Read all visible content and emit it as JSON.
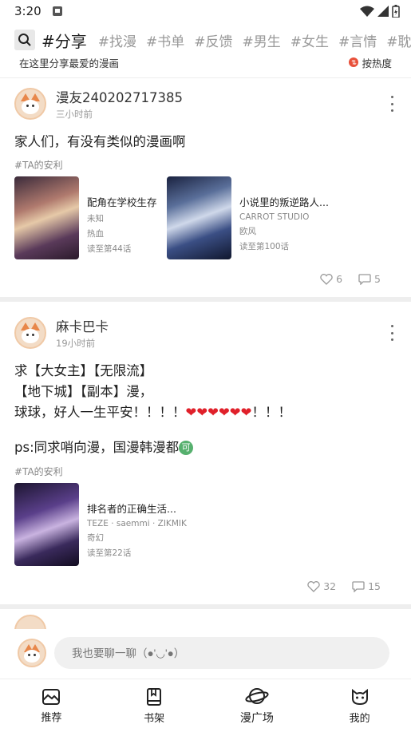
{
  "status_bar": {
    "time": "3:20"
  },
  "tags": {
    "search_icon": "search-icon",
    "items": [
      {
        "label": "#分享",
        "active": true
      },
      {
        "label": "#找漫"
      },
      {
        "label": "#书单"
      },
      {
        "label": "#反馈"
      },
      {
        "label": "#男生"
      },
      {
        "label": "#女生"
      },
      {
        "label": "#言情"
      },
      {
        "label": "#耽美"
      }
    ]
  },
  "subheader": {
    "hint": "在这里分享最爱的漫画",
    "sort_label": "按热度"
  },
  "posts": [
    {
      "username": "漫友240202717385",
      "time": "三小时前",
      "text": "家人们，有没有类似的漫画啊",
      "hashtag": "#TA的安利",
      "comics": [
        {
          "title": "配角在学校生存",
          "author": "未知",
          "genre": "热血",
          "progress": "读至第44话"
        },
        {
          "title": "小说里的叛逆路人...",
          "author": "CARROT STUDIO",
          "genre": "欧风",
          "progress": "读至第100话"
        }
      ],
      "likes": "6",
      "comments": "5"
    },
    {
      "username": "麻卡巴卡",
      "time": "19小时前",
      "text_lines": [
        "求【大女主】【无限流】",
        "【地下城】【副本】漫，",
        "球球，好人一生平安！！！！",
        "❤❤❤❤❤❤",
        "！！！"
      ],
      "ps_text": "ps:同求哨向漫，国漫韩漫都",
      "ps_badge": "可",
      "hashtag": "#TA的安利",
      "comics": [
        {
          "title": "排名者的正确生活...",
          "author": "TEZE · saemmi · ZIKMIK",
          "genre": "奇幻",
          "progress": "读至第22话"
        }
      ],
      "likes": "32",
      "comments": "15"
    }
  ],
  "comment_input": {
    "placeholder": "我也要聊一聊（●'◡'●）"
  },
  "nav": {
    "items": [
      {
        "label": "推荐",
        "icon": "image-icon"
      },
      {
        "label": "书架",
        "icon": "bookshelf-icon"
      },
      {
        "label": "漫广场",
        "icon": "planet-icon",
        "active": true
      },
      {
        "label": "我的",
        "icon": "cat-icon"
      }
    ]
  }
}
